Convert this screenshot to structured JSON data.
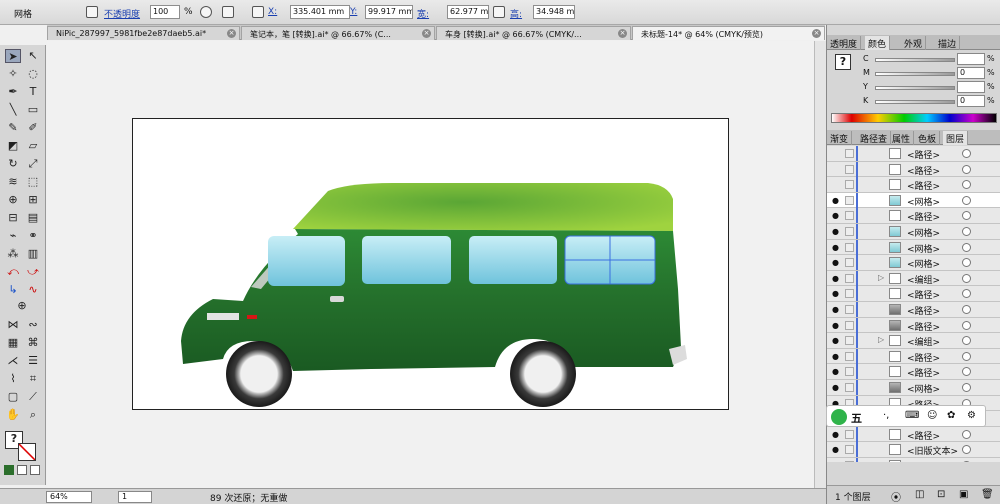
{
  "control_bar": {
    "mode_label": "网格",
    "opacity_label": "不透明度",
    "opacity_value": "100",
    "opacity_unit": "%",
    "x_label": "X:",
    "x_value": "335.401 mm",
    "y_label": "Y:",
    "y_value": "99.917 mm",
    "w_label": "宽:",
    "w_value": "62.977 mm",
    "h_label": "高:",
    "h_value": "34.948 mm"
  },
  "tabs": [
    {
      "label": "NiPic_287997_5981fbe2e87daeb5.ai*"
    },
    {
      "label": "笔记本，笔 [转换].ai* @ 66.67% (C..."
    },
    {
      "label": "车身 [转换].ai* @ 66.67% (CMYK/..."
    },
    {
      "label": "未标题-14* @ 64% (CMYK/预览)"
    }
  ],
  "status_bar": {
    "zoom": "64%",
    "page": "1",
    "undo_info": "89 次还原；无重做"
  },
  "panels": {
    "top_tabs": [
      "透明度",
      "颜色",
      "外观",
      "描边"
    ],
    "active_top_tab": "颜色",
    "sliders": [
      {
        "label": "C",
        "value": "",
        "unit": "%"
      },
      {
        "label": "M",
        "value": "0",
        "unit": "%"
      },
      {
        "label": "Y",
        "value": "",
        "unit": "%"
      },
      {
        "label": "K",
        "value": "0",
        "unit": "%"
      }
    ],
    "mid_tabs": [
      "渐变",
      "路径查",
      "属性",
      "色板",
      "图层"
    ],
    "active_mid_tab": "图层",
    "layers": [
      {
        "name": "<路径>",
        "eye": false,
        "thumb": "plain"
      },
      {
        "name": "<路径>",
        "eye": false,
        "thumb": "plain"
      },
      {
        "name": "<路径>",
        "eye": false,
        "thumb": "plain"
      },
      {
        "name": "<网格>",
        "eye": true,
        "thumb": "glass",
        "selected": true
      },
      {
        "name": "<路径>",
        "eye": true,
        "thumb": "plain"
      },
      {
        "name": "<网格>",
        "eye": true,
        "thumb": "glass"
      },
      {
        "name": "<网格>",
        "eye": true,
        "thumb": "glass"
      },
      {
        "name": "<网格>",
        "eye": true,
        "thumb": "glass"
      },
      {
        "name": "<编组>",
        "eye": true,
        "thumb": "plain",
        "group": true
      },
      {
        "name": "<路径>",
        "eye": true,
        "thumb": "plain"
      },
      {
        "name": "<路径>",
        "eye": true,
        "thumb": "dark"
      },
      {
        "name": "<路径>",
        "eye": true,
        "thumb": "dark"
      },
      {
        "name": "<编组>",
        "eye": true,
        "thumb": "plain",
        "group": true
      },
      {
        "name": "<路径>",
        "eye": true,
        "thumb": "plain"
      },
      {
        "name": "<路径>",
        "eye": true,
        "thumb": "plain"
      },
      {
        "name": "<网格>",
        "eye": true,
        "thumb": "dark"
      },
      {
        "name": "<路径>",
        "eye": true,
        "thumb": "plain"
      },
      {
        "name": "<路径>",
        "eye": true,
        "thumb": "plain"
      },
      {
        "name": "<路径>",
        "eye": true,
        "thumb": "plain"
      },
      {
        "name": "<旧版文本>",
        "eye": true,
        "thumb": "plain"
      },
      {
        "name": "<路径>",
        "eye": true,
        "thumb": "plain"
      }
    ],
    "footer_label": "1 个图层"
  },
  "ime": {
    "label": "五"
  },
  "colors": {
    "van_body_dark": "#1f6b2a",
    "van_body_mid": "#2e8a35",
    "roof": "#8fcc3a",
    "window": "#8fd3e6",
    "selection": "#3a6fe0"
  }
}
